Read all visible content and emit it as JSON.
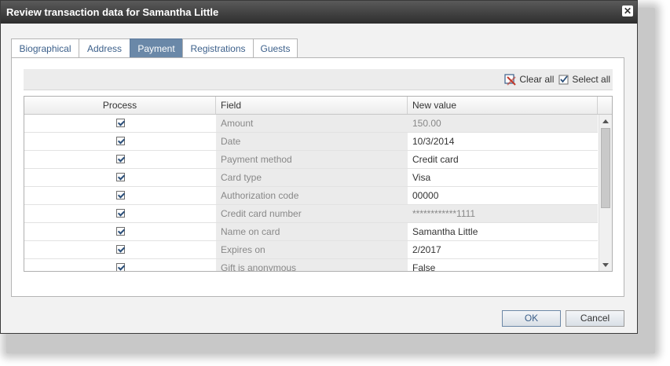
{
  "dialog": {
    "title": "Review transaction data for Samantha Little",
    "close_label": "✕"
  },
  "tabs": [
    {
      "label": "Biographical",
      "active": false
    },
    {
      "label": "Address",
      "active": false
    },
    {
      "label": "Payment",
      "active": true
    },
    {
      "label": "Registrations",
      "active": false
    },
    {
      "label": "Guests",
      "active": false
    }
  ],
  "toolbar": {
    "clear_all_label": "Clear all",
    "select_all_label": "Select all"
  },
  "grid": {
    "headers": {
      "process": "Process",
      "field": "Field",
      "new_value": "New value"
    },
    "rows": [
      {
        "checked": true,
        "field": "Amount",
        "value": "150.00",
        "readonly": true
      },
      {
        "checked": true,
        "field": "Date",
        "value": "10/3/2014",
        "readonly": false
      },
      {
        "checked": true,
        "field": "Payment method",
        "value": "Credit card",
        "readonly": false
      },
      {
        "checked": true,
        "field": "Card type",
        "value": "Visa",
        "readonly": false
      },
      {
        "checked": true,
        "field": "Authorization code",
        "value": "00000",
        "readonly": false
      },
      {
        "checked": true,
        "field": "Credit card number",
        "value": "************1111",
        "readonly": true
      },
      {
        "checked": true,
        "field": "Name on card",
        "value": "Samantha Little",
        "readonly": false
      },
      {
        "checked": true,
        "field": "Expires on",
        "value": "2/2017",
        "readonly": false
      },
      {
        "checked": true,
        "field": "Gift is anonymous",
        "value": "False",
        "readonly": false
      }
    ]
  },
  "buttons": {
    "ok_label": "OK",
    "cancel_label": "Cancel"
  }
}
